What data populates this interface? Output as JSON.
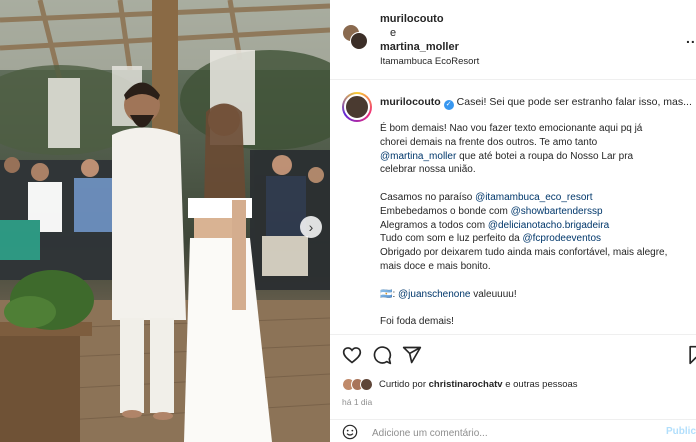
{
  "header": {
    "user1": "murilocouto",
    "conjunction": "e",
    "user2": "martina_moller",
    "location": "Itamambuca EcoResort",
    "more": "..."
  },
  "caption": {
    "username": "murilocouto",
    "headline": "Casei! Sei que pode ser estranho falar isso, mas...",
    "lines": [
      {
        "text": "É bom demais! Nao vou fazer texto emocionante aqui pq já"
      },
      {
        "text": "chorei demais na frente dos outros. Te amo tanto"
      },
      {
        "mention": "@martina_moller",
        "text": " que até botei a roupa do Nosso Lar pra"
      },
      {
        "text": "celebrar nossa união."
      },
      {
        "text": "Casamos no paraíso ",
        "mention": "@itamambuca_eco_resort"
      },
      {
        "text": "Embebedamos o bonde com ",
        "mention": "@showbartenderssp"
      },
      {
        "text": "Alegramos a todos com ",
        "mention": "@delicianotacho.brigadeira"
      },
      {
        "text": "Tudo com som e luz perfeito da ",
        "mention": "@fcprodeeventos"
      },
      {
        "text": "Obrigado por deixarem tudo ainda mais confortável, mais alegre,"
      },
      {
        "text": "mais doce e mais bonito."
      },
      {
        "flag": "🇦🇷",
        "text": ": ",
        "mention": "@juanschenone",
        "suffix": " valeuuuu!"
      },
      {
        "text": "Foi foda demais!"
      }
    ]
  },
  "actions": {
    "like_icon": "heart-icon",
    "comment_icon": "comment-icon",
    "share_icon": "share-icon",
    "likes_prefix": "Curtido por ",
    "likes_user": "christinarochatv",
    "likes_suffix": " e outras pessoas",
    "time": "há 1 dia"
  },
  "comment": {
    "placeholder": "Adicione um comentário...",
    "publish": "Publicar"
  },
  "colors": {
    "mention": "#00376b",
    "verified": "#3897f0",
    "muted": "#8e8e8e"
  }
}
